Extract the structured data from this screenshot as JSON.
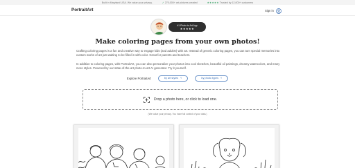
{
  "topbar": {
    "item1": "Built in Maryland USA. We value your privacy.",
    "item2": "270,000+ art pictures created",
    "item3_stars": "★★★★★",
    "item3_text": "Trusted by 12,000+ customers"
  },
  "header": {
    "logo": "PortraitArt",
    "signin": "Sign in"
  },
  "badge": {
    "title": "#1 Photo to Art App",
    "stars": "★★★★★"
  },
  "headline": "Make coloring pages from your own photos!",
  "paragraphs": {
    "p1": "Crafting coloring pages is a fun and creative way to engage kids (and adults!) with art. Instead of generic coloring pages, you can turn special memories into custom works of art just waiting to be filled in with color. Great for parents and teachers.",
    "p2": "In addition to coloring pages, with PortraitArt, you can also personalize your photos into cool sketches, beautiful oil paintings, dreamy watercolors, and many more styles. Powered by our state-of-the-art photo-to-art AI generator. Try it yourself."
  },
  "explore": {
    "label": "Explore PortraitArt",
    "art_styles": "by art styles",
    "photo_types": "by photo types",
    "chevron": "˅"
  },
  "dropzone": {
    "text": "Drop a photo here, or click to load one."
  },
  "privacy": "(We value your privacy. You have full control of your data.)",
  "colors": {
    "accent": "#3a6fb5",
    "brand_dark": "#2f2f2f",
    "star_green": "#2a9d5c"
  }
}
